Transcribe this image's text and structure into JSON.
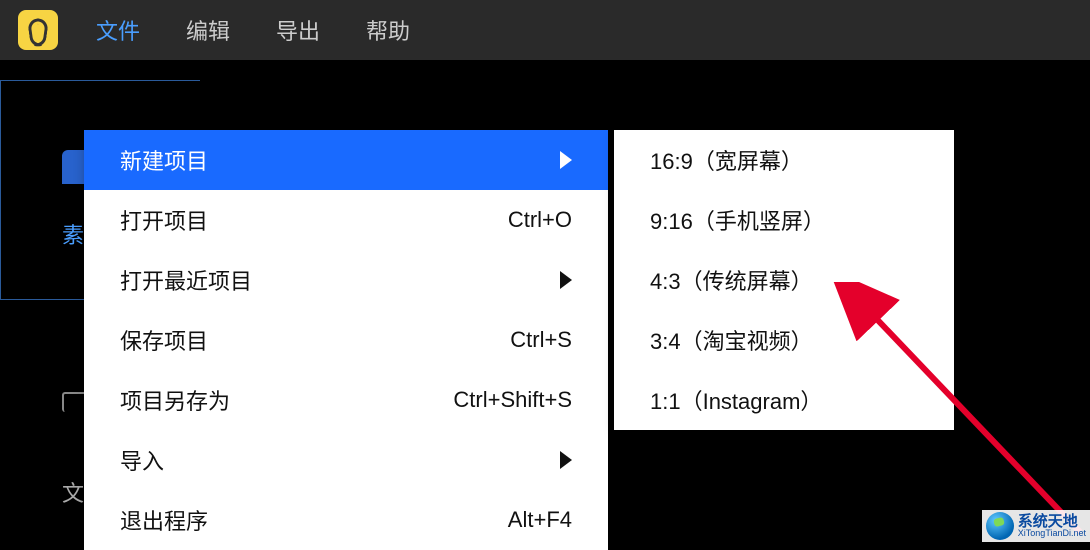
{
  "topbar": {
    "menus": [
      "文件",
      "编辑",
      "导出",
      "帮助"
    ],
    "active_index": 0
  },
  "left_panel": {
    "label": "素"
  },
  "snippet_text": "文",
  "file_menu": {
    "items": [
      {
        "label": "新建项目",
        "shortcut": "",
        "has_submenu": true,
        "highlighted": true
      },
      {
        "label": "打开项目",
        "shortcut": "Ctrl+O",
        "has_submenu": false,
        "highlighted": false
      },
      {
        "label": "打开最近项目",
        "shortcut": "",
        "has_submenu": true,
        "highlighted": false
      },
      {
        "label": "保存项目",
        "shortcut": "Ctrl+S",
        "has_submenu": false,
        "highlighted": false
      },
      {
        "label": "项目另存为",
        "shortcut": "Ctrl+Shift+S",
        "has_submenu": false,
        "highlighted": false
      },
      {
        "label": "导入",
        "shortcut": "",
        "has_submenu": true,
        "highlighted": false
      },
      {
        "label": "退出程序",
        "shortcut": "Alt+F4",
        "has_submenu": false,
        "highlighted": false
      }
    ]
  },
  "new_project_submenu": {
    "items": [
      {
        "label": "16:9（宽屏幕）"
      },
      {
        "label": "9:16（手机竖屏）"
      },
      {
        "label": "4:3（传统屏幕）"
      },
      {
        "label": "3:4（淘宝视频）"
      },
      {
        "label": "1:1（Instagram）"
      }
    ]
  },
  "watermark": {
    "name_cn": "系统天地",
    "name_en": "XiTongTianDi.net"
  },
  "colors": {
    "accent": "#196aff",
    "highlight_text": "#4a9eff",
    "logo_bg": "#f7d443",
    "topbar_bg": "#2a2a2a",
    "arrow": "#e4002b"
  }
}
